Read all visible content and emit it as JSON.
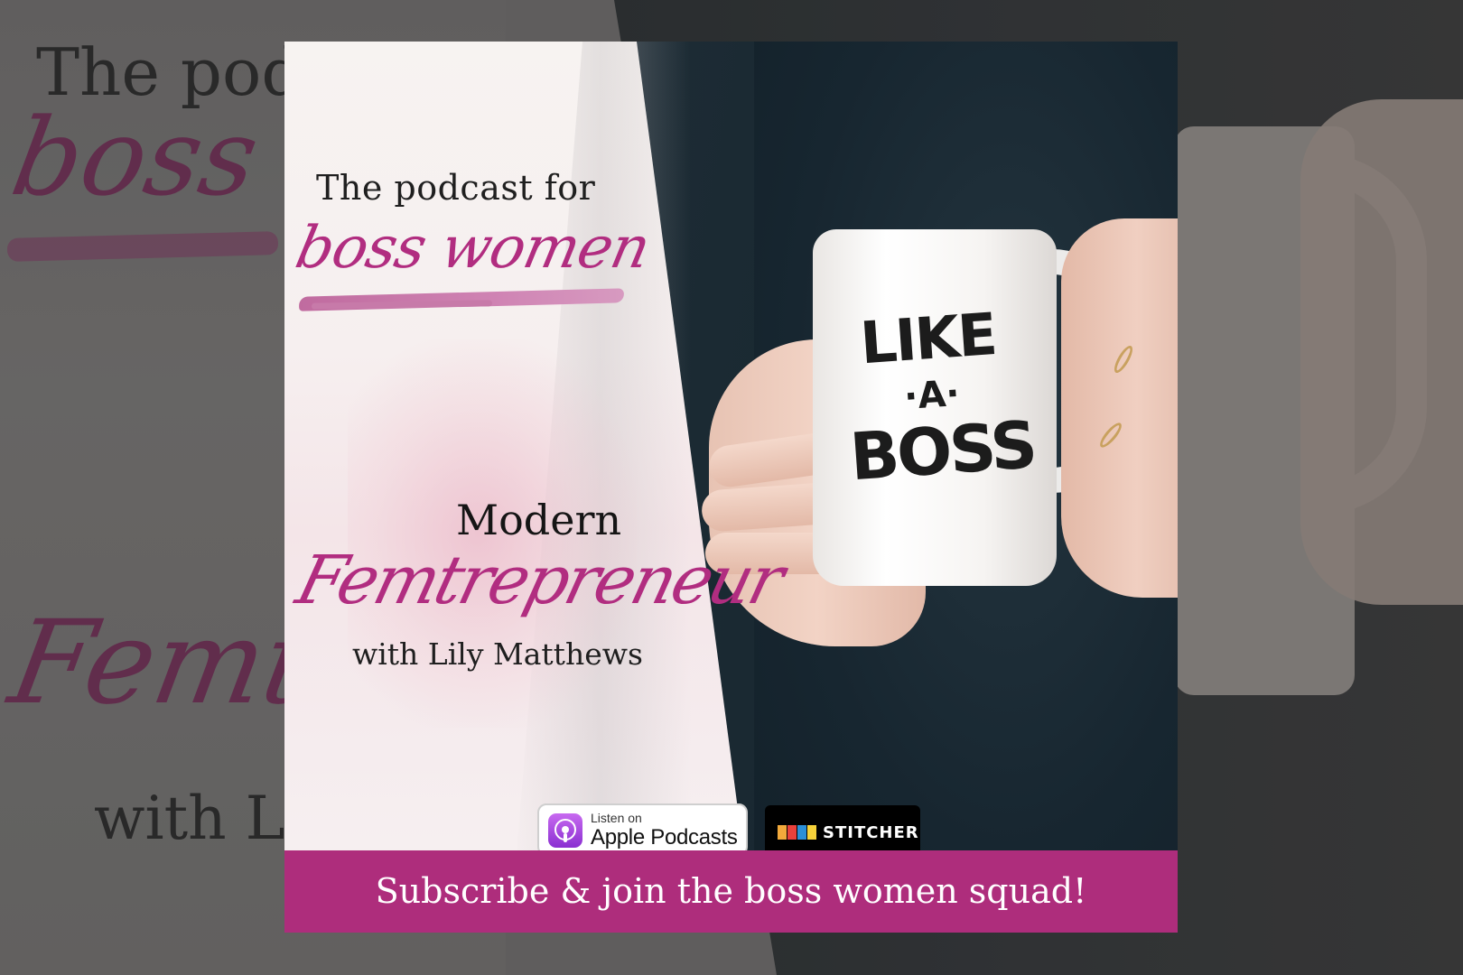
{
  "background": {
    "tagline": "The podcast for",
    "script_title": "boss women",
    "show_script": "Femtrepreneur",
    "host": "with Lily Matthews"
  },
  "card": {
    "tagline": "The podcast for",
    "script_title": "boss women",
    "show_name_top": "Modern",
    "show_name_script": "Femtrepreneur",
    "host": "with Lily Matthews",
    "mug": {
      "line1": "LIKE",
      "line2": "·A·",
      "line3": "BOSS"
    },
    "badges": {
      "apple": {
        "small": "Listen on",
        "big": "Apple Podcasts",
        "icon": "apple-podcasts-icon"
      },
      "stitcher": {
        "label": "STITCHER",
        "icon": "stitcher-bars-icon"
      }
    },
    "banner": "Subscribe & join the boss women squad!"
  },
  "colors": {
    "accent": "#b12d80",
    "banner": "#ae2d7c",
    "stitcher_bars": [
      "#f2a93b",
      "#e8413c",
      "#2b8fd6",
      "#f6d23a"
    ]
  }
}
